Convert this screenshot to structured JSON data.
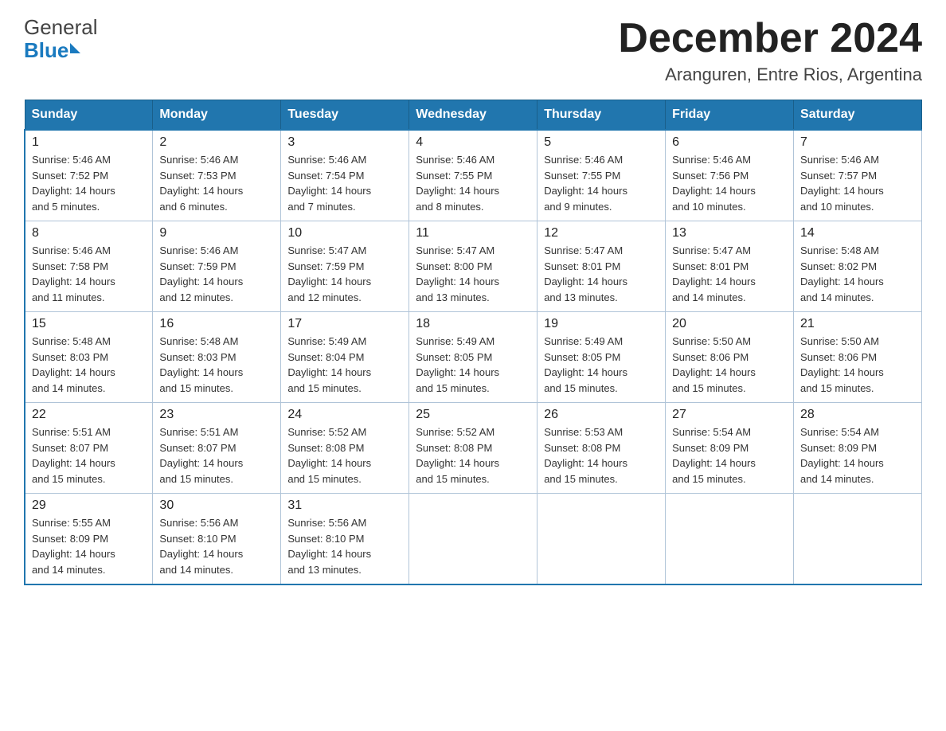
{
  "header": {
    "logo_general": "General",
    "logo_blue": "Blue",
    "month_year": "December 2024",
    "location": "Aranguren, Entre Rios, Argentina"
  },
  "days_of_week": [
    "Sunday",
    "Monday",
    "Tuesday",
    "Wednesday",
    "Thursday",
    "Friday",
    "Saturday"
  ],
  "weeks": [
    [
      {
        "day": "1",
        "sunrise": "5:46 AM",
        "sunset": "7:52 PM",
        "daylight": "14 hours and 5 minutes."
      },
      {
        "day": "2",
        "sunrise": "5:46 AM",
        "sunset": "7:53 PM",
        "daylight": "14 hours and 6 minutes."
      },
      {
        "day": "3",
        "sunrise": "5:46 AM",
        "sunset": "7:54 PM",
        "daylight": "14 hours and 7 minutes."
      },
      {
        "day": "4",
        "sunrise": "5:46 AM",
        "sunset": "7:55 PM",
        "daylight": "14 hours and 8 minutes."
      },
      {
        "day": "5",
        "sunrise": "5:46 AM",
        "sunset": "7:55 PM",
        "daylight": "14 hours and 9 minutes."
      },
      {
        "day": "6",
        "sunrise": "5:46 AM",
        "sunset": "7:56 PM",
        "daylight": "14 hours and 10 minutes."
      },
      {
        "day": "7",
        "sunrise": "5:46 AM",
        "sunset": "7:57 PM",
        "daylight": "14 hours and 10 minutes."
      }
    ],
    [
      {
        "day": "8",
        "sunrise": "5:46 AM",
        "sunset": "7:58 PM",
        "daylight": "14 hours and 11 minutes."
      },
      {
        "day": "9",
        "sunrise": "5:46 AM",
        "sunset": "7:59 PM",
        "daylight": "14 hours and 12 minutes."
      },
      {
        "day": "10",
        "sunrise": "5:47 AM",
        "sunset": "7:59 PM",
        "daylight": "14 hours and 12 minutes."
      },
      {
        "day": "11",
        "sunrise": "5:47 AM",
        "sunset": "8:00 PM",
        "daylight": "14 hours and 13 minutes."
      },
      {
        "day": "12",
        "sunrise": "5:47 AM",
        "sunset": "8:01 PM",
        "daylight": "14 hours and 13 minutes."
      },
      {
        "day": "13",
        "sunrise": "5:47 AM",
        "sunset": "8:01 PM",
        "daylight": "14 hours and 14 minutes."
      },
      {
        "day": "14",
        "sunrise": "5:48 AM",
        "sunset": "8:02 PM",
        "daylight": "14 hours and 14 minutes."
      }
    ],
    [
      {
        "day": "15",
        "sunrise": "5:48 AM",
        "sunset": "8:03 PM",
        "daylight": "14 hours and 14 minutes."
      },
      {
        "day": "16",
        "sunrise": "5:48 AM",
        "sunset": "8:03 PM",
        "daylight": "14 hours and 15 minutes."
      },
      {
        "day": "17",
        "sunrise": "5:49 AM",
        "sunset": "8:04 PM",
        "daylight": "14 hours and 15 minutes."
      },
      {
        "day": "18",
        "sunrise": "5:49 AM",
        "sunset": "8:05 PM",
        "daylight": "14 hours and 15 minutes."
      },
      {
        "day": "19",
        "sunrise": "5:49 AM",
        "sunset": "8:05 PM",
        "daylight": "14 hours and 15 minutes."
      },
      {
        "day": "20",
        "sunrise": "5:50 AM",
        "sunset": "8:06 PM",
        "daylight": "14 hours and 15 minutes."
      },
      {
        "day": "21",
        "sunrise": "5:50 AM",
        "sunset": "8:06 PM",
        "daylight": "14 hours and 15 minutes."
      }
    ],
    [
      {
        "day": "22",
        "sunrise": "5:51 AM",
        "sunset": "8:07 PM",
        "daylight": "14 hours and 15 minutes."
      },
      {
        "day": "23",
        "sunrise": "5:51 AM",
        "sunset": "8:07 PM",
        "daylight": "14 hours and 15 minutes."
      },
      {
        "day": "24",
        "sunrise": "5:52 AM",
        "sunset": "8:08 PM",
        "daylight": "14 hours and 15 minutes."
      },
      {
        "day": "25",
        "sunrise": "5:52 AM",
        "sunset": "8:08 PM",
        "daylight": "14 hours and 15 minutes."
      },
      {
        "day": "26",
        "sunrise": "5:53 AM",
        "sunset": "8:08 PM",
        "daylight": "14 hours and 15 minutes."
      },
      {
        "day": "27",
        "sunrise": "5:54 AM",
        "sunset": "8:09 PM",
        "daylight": "14 hours and 15 minutes."
      },
      {
        "day": "28",
        "sunrise": "5:54 AM",
        "sunset": "8:09 PM",
        "daylight": "14 hours and 14 minutes."
      }
    ],
    [
      {
        "day": "29",
        "sunrise": "5:55 AM",
        "sunset": "8:09 PM",
        "daylight": "14 hours and 14 minutes."
      },
      {
        "day": "30",
        "sunrise": "5:56 AM",
        "sunset": "8:10 PM",
        "daylight": "14 hours and 14 minutes."
      },
      {
        "day": "31",
        "sunrise": "5:56 AM",
        "sunset": "8:10 PM",
        "daylight": "14 hours and 13 minutes."
      },
      null,
      null,
      null,
      null
    ]
  ],
  "labels": {
    "sunrise": "Sunrise:",
    "sunset": "Sunset:",
    "daylight": "Daylight:"
  }
}
